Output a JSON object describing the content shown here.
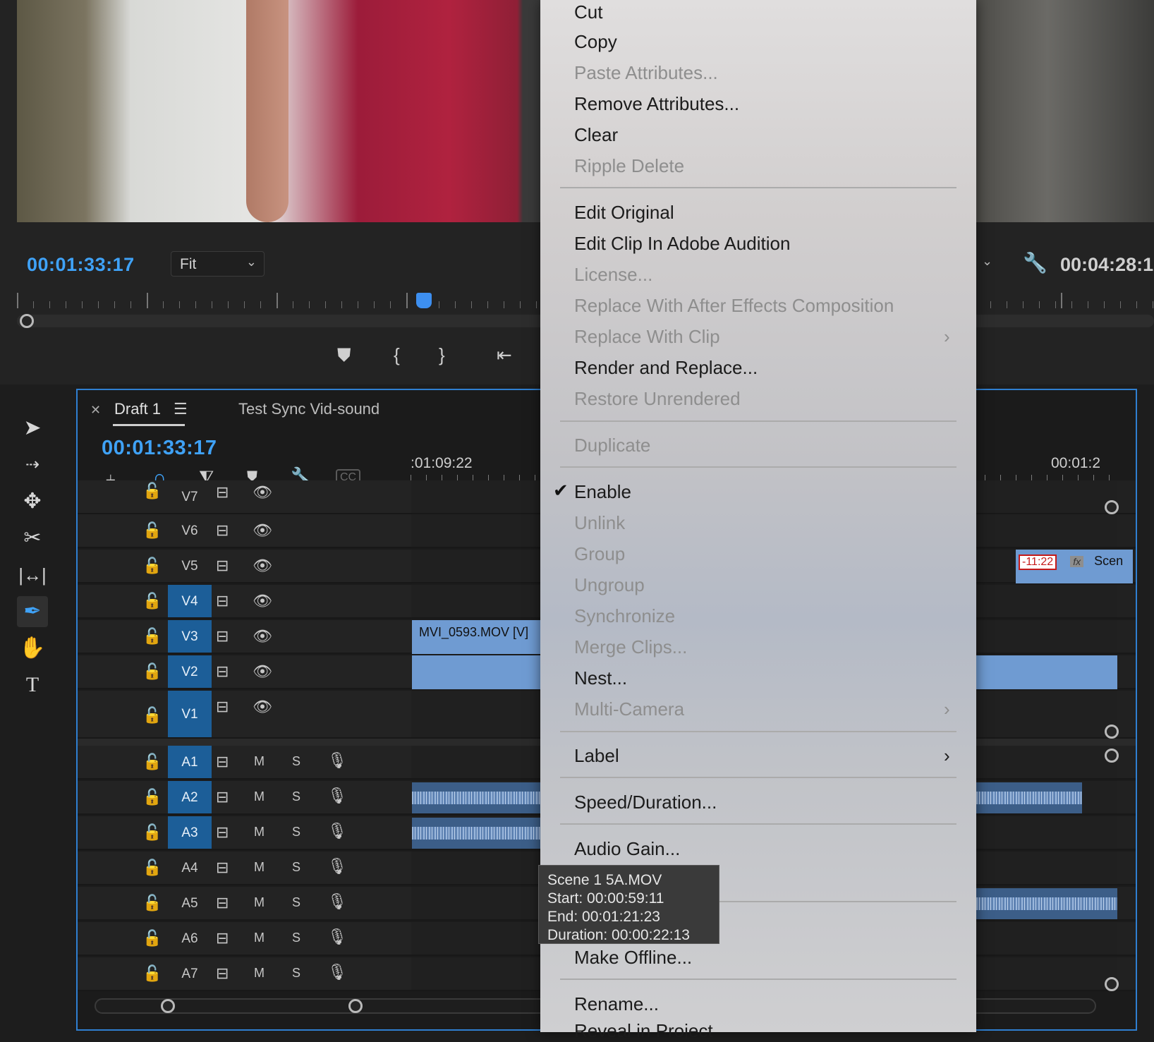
{
  "monitor": {
    "timecode": "00:01:33:17",
    "fit": "Fit",
    "duration_timecode": "00:04:28:1"
  },
  "timeline": {
    "tabs": [
      {
        "label": "Draft 1",
        "active": true
      },
      {
        "label": "Test Sync Vid-sound",
        "active": false
      }
    ],
    "timecode": "00:01:33:17",
    "ruler_left": ":01:09:22",
    "ruler_right": "00:01:2",
    "video_tracks": [
      {
        "name": "V7",
        "targeted": false
      },
      {
        "name": "V6",
        "targeted": false
      },
      {
        "name": "V5",
        "targeted": false
      },
      {
        "name": "V4",
        "targeted": true
      },
      {
        "name": "V3",
        "targeted": true
      },
      {
        "name": "V2",
        "targeted": true
      },
      {
        "name": "V1",
        "targeted": true
      }
    ],
    "audio_tracks": [
      {
        "name": "A1",
        "targeted": true
      },
      {
        "name": "A2",
        "targeted": true
      },
      {
        "name": "A3",
        "targeted": true
      },
      {
        "name": "A4",
        "targeted": false
      },
      {
        "name": "A5",
        "targeted": false
      },
      {
        "name": "A6",
        "targeted": false
      },
      {
        "name": "A7",
        "targeted": false
      }
    ],
    "mute_label": "M",
    "solo_label": "S",
    "clip_v3_label": "MVI_0593.MOV [V]",
    "clip_v5_time": "-11:22",
    "clip_v5_name": "Scen",
    "fx_label": "fx"
  },
  "context_menu": {
    "items": [
      {
        "label": "Cut",
        "enabled": true
      },
      {
        "label": "Copy",
        "enabled": true
      },
      {
        "label": "Paste Attributes...",
        "enabled": false
      },
      {
        "label": "Remove Attributes...",
        "enabled": true
      },
      {
        "label": "Clear",
        "enabled": true
      },
      {
        "label": "Ripple Delete",
        "enabled": false
      },
      {
        "label": "Edit Original",
        "enabled": true
      },
      {
        "label": "Edit Clip In Adobe Audition",
        "enabled": true
      },
      {
        "label": "License...",
        "enabled": false
      },
      {
        "label": "Replace With After Effects Composition",
        "enabled": false
      },
      {
        "label": "Replace With Clip",
        "enabled": false,
        "submenu": true
      },
      {
        "label": "Render and Replace...",
        "enabled": true
      },
      {
        "label": "Restore Unrendered",
        "enabled": false
      },
      {
        "label": "Duplicate",
        "enabled": false
      },
      {
        "label": "Enable",
        "enabled": true,
        "checked": true
      },
      {
        "label": "Unlink",
        "enabled": false
      },
      {
        "label": "Group",
        "enabled": false
      },
      {
        "label": "Ungroup",
        "enabled": false
      },
      {
        "label": "Synchronize",
        "enabled": false
      },
      {
        "label": "Merge Clips...",
        "enabled": false
      },
      {
        "label": "Nest...",
        "enabled": true
      },
      {
        "label": "Multi-Camera",
        "enabled": false,
        "submenu": true
      },
      {
        "label": "Label",
        "enabled": true,
        "submenu": true
      },
      {
        "label": "Speed/Duration...",
        "enabled": true
      },
      {
        "label": "Audio Gain...",
        "enabled": true
      },
      {
        "label": "Make Offline...",
        "enabled": true
      },
      {
        "label": "Rename...",
        "enabled": true
      },
      {
        "label": "Reveal in Project",
        "enabled": true
      }
    ]
  },
  "tooltip": {
    "line1": "Scene 1 5A.MOV",
    "line2": "Start: 00:00:59:11",
    "line3": "End: 00:01:21:23",
    "line4": "Duration: 00:00:22:13"
  },
  "colors": {
    "accent": "#3fa2f7",
    "track_target": "#1c5e98",
    "clip_video": "#6f9bd2",
    "timeline_border": "#2f7fd1"
  }
}
